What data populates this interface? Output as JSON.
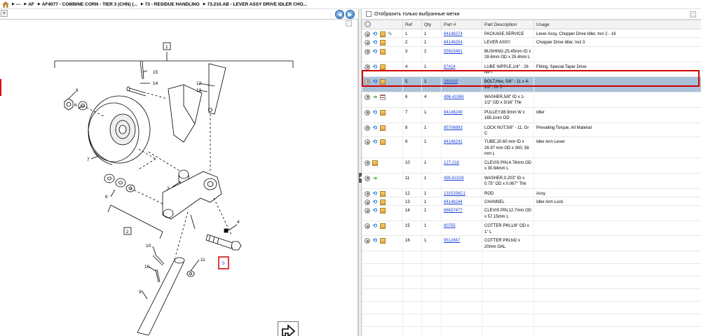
{
  "breadcrumb": {
    "items": [
      "---",
      "AF",
      "AF4077 - COMBINE CORN - TIER 3 (CHN) (...",
      "73 - RESIDUE HANDLING",
      "73.210.AB - LEVER ASSY DRIVE IDLER CHO..."
    ]
  },
  "left_pane": {
    "expand_label": "+",
    "back_label": "◀",
    "forward_label": "▶",
    "diagram": {
      "callouts": [
        "1",
        "2",
        "3",
        "4",
        "5",
        "6",
        "6",
        "7",
        "8",
        "9",
        "10",
        "11",
        "12",
        "13",
        "14",
        "15",
        "16"
      ],
      "highlighted_callout": "5"
    }
  },
  "right_pane": {
    "filter_label": "Отобразить только выбранные метки",
    "columns": [
      "Ref",
      "Qty",
      "Part #",
      "Part Description",
      "Usage"
    ],
    "rows": [
      {
        "ref": "1",
        "qty": "1",
        "part": "84146274",
        "desc": "PACKAGE,SERVICE",
        "usage": "Lever Assy, Chopper Drive Idler, Incl 2 - 16",
        "icons": [
          "blue",
          "box",
          "tool"
        ]
      },
      {
        "ref": "2",
        "qty": "1",
        "part": "84146254",
        "desc": "LEVER ASSY.",
        "usage": "Chopper Drive Idler, Incl 3",
        "icons": [
          "blue",
          "box"
        ]
      },
      {
        "ref": "3",
        "qty": "2",
        "part": "55915481",
        "desc": "BUSHING,25.45mm ID x 28.6mm OD x 25.4mm L",
        "usage": "",
        "icons": [
          "blue",
          "box"
        ]
      },
      {
        "ref": "4",
        "qty": "1",
        "part": "87414",
        "desc": "LUBE NIPPLE,1/4\" - 28 NPT",
        "usage": "Fitting, Special Taper Drive",
        "icons": [
          "blue",
          "box"
        ]
      },
      {
        "ref": "5",
        "qty": "1",
        "part": "280183",
        "desc": "BOLT,Hex, 5/8\" - 11 x 4-1/2\", Gr 5",
        "usage": "",
        "icons": [
          "blue",
          "box"
        ],
        "selected": true
      },
      {
        "ref": "6",
        "qty": "4",
        "part": "496-41066",
        "desc": "WASHER,5/8\" ID x 1-1/2\" OD x 3/16\" Thk",
        "usage": "",
        "icons": [
          "green",
          "list"
        ]
      },
      {
        "ref": "7",
        "qty": "1",
        "part": "84146249",
        "desc": "PULLEY,88.9mm W x 165.1mm OD",
        "usage": "Idler",
        "icons": [
          "blue",
          "box"
        ]
      },
      {
        "ref": "8",
        "qty": "1",
        "part": "85706693",
        "desc": "LOCK NUT,5/8\" - 11, Gr C",
        "usage": "Prevailing Torque, All Material",
        "icons": [
          "blue",
          "box"
        ]
      },
      {
        "ref": "9",
        "qty": "1",
        "part": "84146241",
        "desc": "TUBE,20.60 mm ID x 26.97 mm OD x 300, 56 mm L",
        "usage": "Idler Arm Lever",
        "icons": [
          "blue",
          "box"
        ]
      },
      {
        "ref": "10",
        "qty": "1",
        "part": "127-218",
        "desc": "CLEVIS PIN,4.76mm OD x 30.94mm L",
        "usage": "",
        "icons": [
          "box"
        ]
      },
      {
        "ref": "11",
        "qty": "1",
        "part": "495-61028",
        "desc": "WASHER,0.203\" ID x 0.75\" OD x 0.067\" Thk",
        "usage": "",
        "icons": [
          "green"
        ]
      },
      {
        "ref": "12",
        "qty": "1",
        "part": "1315256C1",
        "desc": "ROD",
        "usage": "Assy",
        "icons": [
          "blue",
          "box"
        ]
      },
      {
        "ref": "13",
        "qty": "1",
        "part": "84146244",
        "desc": "CHANNEL",
        "usage": "Idler Arm Lock",
        "icons": [
          "blue",
          "box"
        ]
      },
      {
        "ref": "14",
        "qty": "1",
        "part": "86637477",
        "desc": "CLEVIS PIN,12.7mm OD x 57.15mm L",
        "usage": "",
        "icons": [
          "blue",
          "box"
        ]
      },
      {
        "ref": "15",
        "qty": "1",
        "part": "80755",
        "desc": "COTTER PIN,1/8\" OD x 1\" L",
        "usage": "",
        "icons": [
          "blue",
          "box"
        ]
      },
      {
        "ref": "16",
        "qty": "1",
        "part": "9512667",
        "desc": "COTTER PIN,M2 x 20mm OAL",
        "usage": "",
        "icons": [
          "blue",
          "box"
        ]
      }
    ],
    "empty_rows": 8
  },
  "colors": {
    "selected_row": "#a9c1d8",
    "highlight_red": "#d40000",
    "link": "#1a3fd6"
  }
}
